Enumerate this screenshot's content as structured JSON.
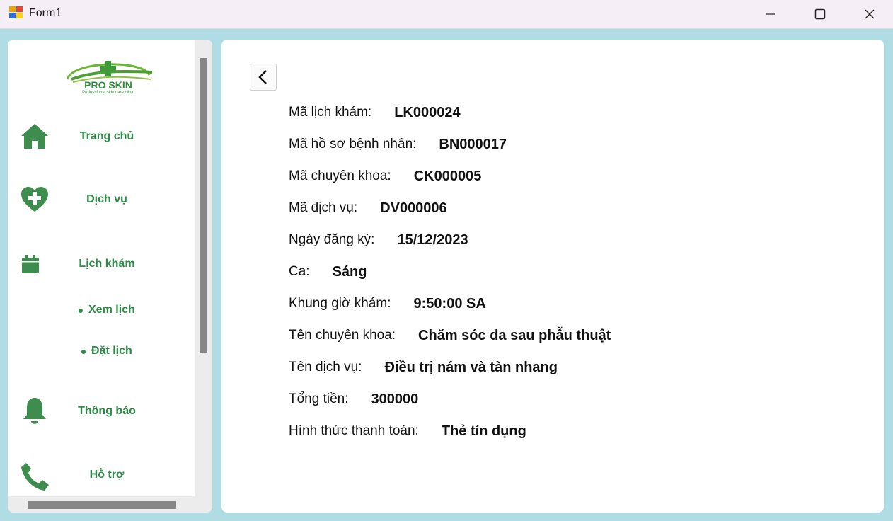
{
  "window": {
    "title": "Form1"
  },
  "logo": {
    "text": "PRO SKIN",
    "tagline": "Professional skin care clinic"
  },
  "sidebar": {
    "items": [
      {
        "label": "Trang chủ",
        "icon": "home-icon"
      },
      {
        "label": "Dịch vụ",
        "icon": "heart-plus-icon"
      },
      {
        "label": "Lịch khám",
        "icon": "calendar-icon"
      },
      {
        "label": "Thông báo",
        "icon": "bell-icon"
      },
      {
        "label": "Hỗ trợ",
        "icon": "phone-icon"
      }
    ],
    "subitems": [
      {
        "label": "Xem lịch"
      },
      {
        "label": "Đặt lịch"
      }
    ]
  },
  "details": [
    {
      "label": "Mã lịch khám:",
      "value": "LK000024"
    },
    {
      "label": "Mã hồ sơ bệnh nhân:",
      "value": "BN000017"
    },
    {
      "label": "Mã chuyên khoa:",
      "value": "CK000005"
    },
    {
      "label": "Mã dịch vụ:",
      "value": "DV000006"
    },
    {
      "label": "Ngày đăng ký:",
      "value": "15/12/2023"
    },
    {
      "label": "Ca:",
      "value": "Sáng"
    },
    {
      "label": "Khung giờ khám:",
      "value": "9:50:00 SA"
    },
    {
      "label": "Tên chuyên khoa:",
      "value": "Chăm sóc da sau phẫu thuật"
    },
    {
      "label": "Tên dịch vụ:",
      "value": "Điều trị nám và tàn nhang"
    },
    {
      "label": "Tổng tiền:",
      "value": "300000"
    },
    {
      "label": "Hình thức thanh toán:",
      "value": "Thẻ tín dụng"
    }
  ],
  "colors": {
    "accent": "#2e8b47",
    "icon_green": "#3f8d4e",
    "background": "#b0dde3"
  }
}
